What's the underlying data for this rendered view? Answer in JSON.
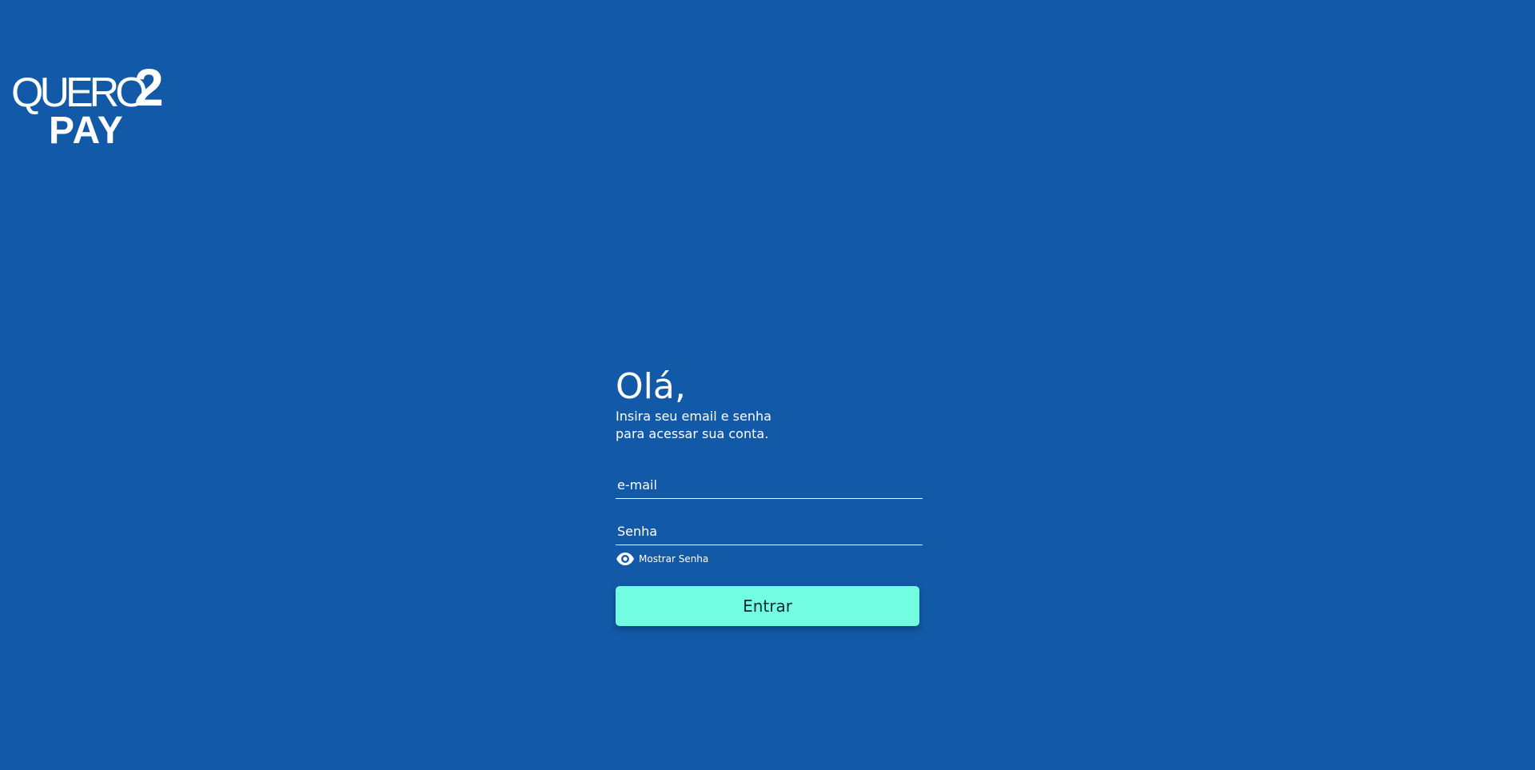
{
  "brand": {
    "logo_quero": "QUERO",
    "logo_two": "2",
    "logo_pay": "PAY"
  },
  "login": {
    "greeting": "Olá,",
    "subtitle_line1": "Insira seu email e senha",
    "subtitle_line2": "para acessar sua conta.",
    "email_placeholder": "e-mail",
    "email_value": "",
    "password_placeholder": "Senha",
    "password_value": "",
    "show_password_label": "Mostrar Senha",
    "show_password_icon": "eye-icon",
    "submit_label": "Entrar"
  },
  "colors": {
    "background": "#1259a8",
    "button": "#72fde1",
    "button_text": "#0a2a3a",
    "text": "#ffffff"
  }
}
